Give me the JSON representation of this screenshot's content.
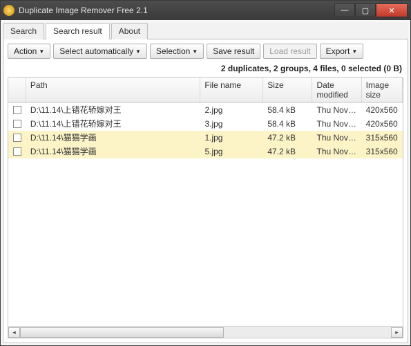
{
  "window": {
    "title": "Duplicate Image Remover Free 2.1"
  },
  "tabs": [
    {
      "label": "Search"
    },
    {
      "label": "Search result"
    },
    {
      "label": "About"
    }
  ],
  "toolbar": {
    "action": "Action",
    "select_auto": "Select automatically",
    "selection": "Selection",
    "save_result": "Save result",
    "load_result": "Load result",
    "export": "Export"
  },
  "status": "2 duplicates, 2 groups, 4 files, 0 selected (0 B)",
  "columns": {
    "path": "Path",
    "file": "File name",
    "size": "Size",
    "date": "Date modified",
    "img": "Image size"
  },
  "rows": [
    {
      "path": "D:\\11.14\\上错花轿嫁对王",
      "file": "2.jpg",
      "size": "58.4 kB",
      "date": "Thu Nov 14 ...",
      "img": "420x560",
      "group": "a"
    },
    {
      "path": "D:\\11.14\\上错花轿嫁对王",
      "file": "3.jpg",
      "size": "58.4 kB",
      "date": "Thu Nov 14 ...",
      "img": "420x560",
      "group": "a"
    },
    {
      "path": "D:\\11.14\\猫猫学画",
      "file": "1.jpg",
      "size": "47.2 kB",
      "date": "Thu Nov 14 ...",
      "img": "315x560",
      "group": "b"
    },
    {
      "path": "D:\\11.14\\猫猫学画",
      "file": "5.jpg",
      "size": "47.2 kB",
      "date": "Thu Nov 14 ...",
      "img": "315x560",
      "group": "b"
    }
  ]
}
